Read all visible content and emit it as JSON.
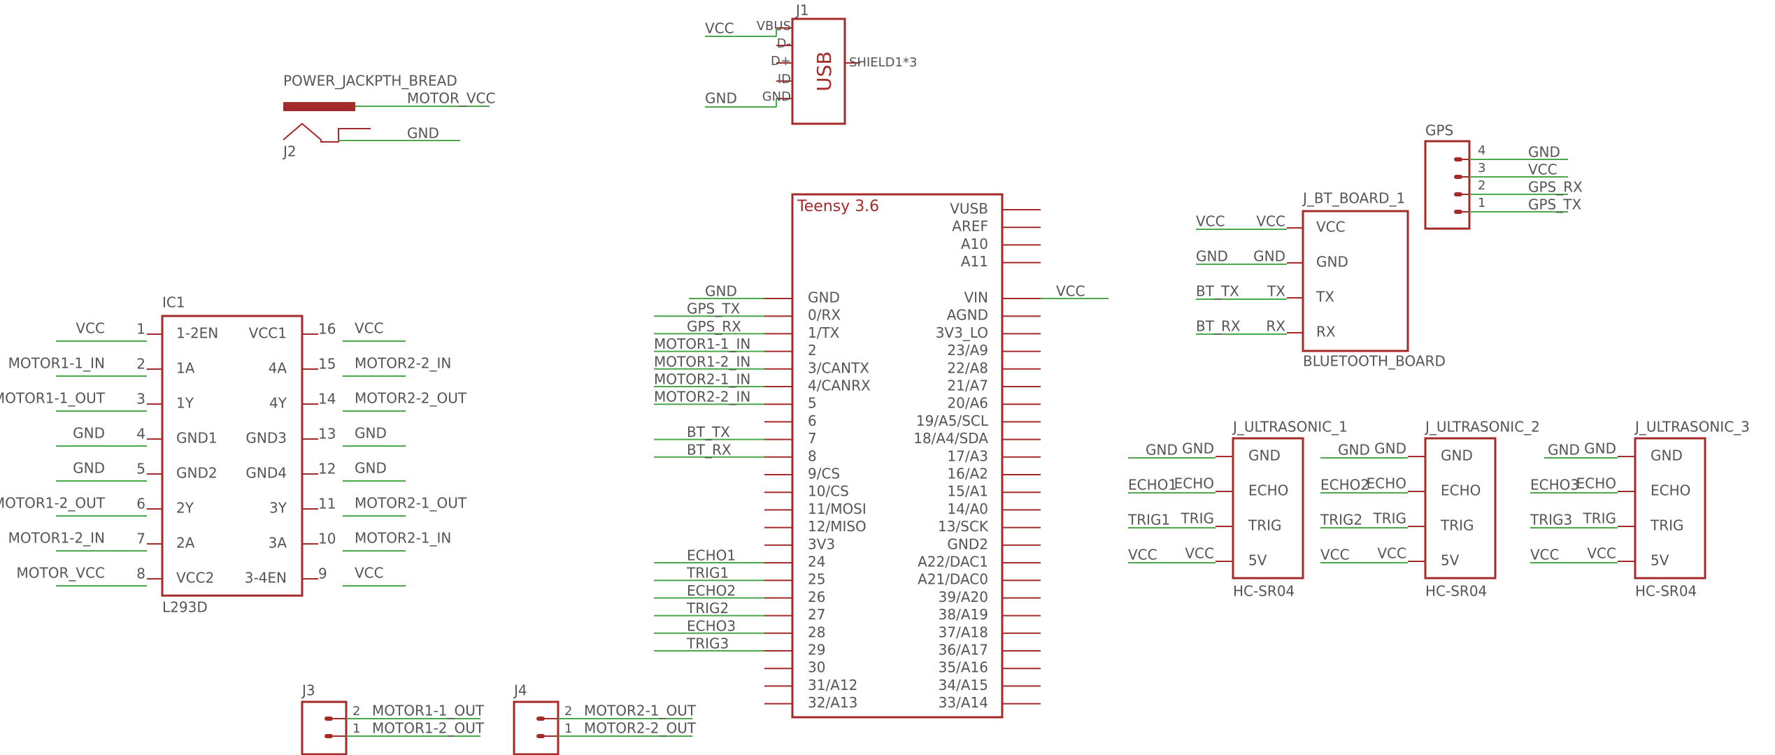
{
  "colors": {
    "body": "#a52a2a",
    "wire": "#4ca64c",
    "label": "#555555",
    "background": "#ffffff"
  },
  "power_jack": {
    "title": "POWER_JACKPTH_BREAD",
    "ref": "J2",
    "net1": "MOTOR_VCC",
    "net2": "GND"
  },
  "usb": {
    "ref": "J1",
    "text": "USB",
    "pins": [
      "VBUS",
      "D-",
      "D+",
      "ID",
      "GND"
    ],
    "shield": "SHIELD1*3",
    "net_vcc": "VCC",
    "net_gnd": "GND"
  },
  "ic1": {
    "ref": "IC1",
    "value": "L293D",
    "left": [
      {
        "num": "1",
        "name": "1-2EN",
        "net": "VCC"
      },
      {
        "num": "2",
        "name": "1A",
        "net": "MOTOR1-1_IN"
      },
      {
        "num": "3",
        "name": "1Y",
        "net": "MOTOR1-1_OUT"
      },
      {
        "num": "4",
        "name": "GND1",
        "net": "GND"
      },
      {
        "num": "5",
        "name": "GND2",
        "net": "GND"
      },
      {
        "num": "6",
        "name": "2Y",
        "net": "MOTOR1-2_OUT"
      },
      {
        "num": "7",
        "name": "2A",
        "net": "MOTOR1-2_IN"
      },
      {
        "num": "8",
        "name": "VCC2",
        "net": "MOTOR_VCC"
      }
    ],
    "right": [
      {
        "num": "16",
        "name": "VCC1",
        "net": "VCC"
      },
      {
        "num": "15",
        "name": "4A",
        "net": "MOTOR2-2_IN"
      },
      {
        "num": "14",
        "name": "4Y",
        "net": "MOTOR2-2_OUT"
      },
      {
        "num": "13",
        "name": "GND3",
        "net": "GND"
      },
      {
        "num": "12",
        "name": "GND4",
        "net": "GND"
      },
      {
        "num": "11",
        "name": "3Y",
        "net": "MOTOR2-1_OUT"
      },
      {
        "num": "10",
        "name": "3A",
        "net": "MOTOR2-1_IN"
      },
      {
        "num": "9",
        "name": "3-4EN",
        "net": "VCC"
      }
    ]
  },
  "teensy": {
    "title": "Teensy 3.6",
    "left": [
      {
        "name": "GND",
        "net": "GND"
      },
      {
        "name": "0/RX",
        "net": "GPS_TX"
      },
      {
        "name": "1/TX",
        "net": "GPS_RX"
      },
      {
        "name": "2",
        "net": "MOTOR1-1_IN"
      },
      {
        "name": "3/CANTX",
        "net": "MOTOR1-2_IN"
      },
      {
        "name": "4/CANRX",
        "net": "MOTOR2-1_IN"
      },
      {
        "name": "5",
        "net": "MOTOR2-2_IN"
      },
      {
        "name": "6",
        "net": ""
      },
      {
        "name": "7",
        "net": "BT_TX"
      },
      {
        "name": "8",
        "net": "BT_RX"
      },
      {
        "name": "9/CS",
        "net": ""
      },
      {
        "name": "10/CS",
        "net": ""
      },
      {
        "name": "11/MOSI",
        "net": ""
      },
      {
        "name": "12/MISO",
        "net": ""
      },
      {
        "name": "3V3",
        "net": ""
      },
      {
        "name": "24",
        "net": "ECHO1"
      },
      {
        "name": "25",
        "net": "TRIG1"
      },
      {
        "name": "26",
        "net": "ECHO2"
      },
      {
        "name": "27",
        "net": "TRIG2"
      },
      {
        "name": "28",
        "net": "ECHO3"
      },
      {
        "name": "29",
        "net": "TRIG3"
      },
      {
        "name": "30",
        "net": ""
      },
      {
        "name": "31/A12",
        "net": ""
      },
      {
        "name": "32/A13",
        "net": ""
      }
    ],
    "right_top": [
      {
        "name": "VUSB",
        "net": ""
      },
      {
        "name": "AREF",
        "net": ""
      },
      {
        "name": "A10",
        "net": ""
      },
      {
        "name": "A11",
        "net": ""
      }
    ],
    "right": [
      {
        "name": "VIN",
        "net": "VCC"
      },
      {
        "name": "AGND",
        "net": ""
      },
      {
        "name": "3V3_LO",
        "net": ""
      },
      {
        "name": "23/A9",
        "net": ""
      },
      {
        "name": "22/A8",
        "net": ""
      },
      {
        "name": "21/A7",
        "net": ""
      },
      {
        "name": "20/A6",
        "net": ""
      },
      {
        "name": "19/A5/SCL",
        "net": ""
      },
      {
        "name": "18/A4/SDA",
        "net": ""
      },
      {
        "name": "17/A3",
        "net": ""
      },
      {
        "name": "16/A2",
        "net": ""
      },
      {
        "name": "15/A1",
        "net": ""
      },
      {
        "name": "14/A0",
        "net": ""
      },
      {
        "name": "13/SCK",
        "net": ""
      },
      {
        "name": "GND2",
        "net": ""
      },
      {
        "name": "A22/DAC1",
        "net": ""
      },
      {
        "name": "A21/DAC0",
        "net": ""
      },
      {
        "name": "39/A20",
        "net": ""
      },
      {
        "name": "38/A19",
        "net": ""
      },
      {
        "name": "37/A18",
        "net": ""
      },
      {
        "name": "36/A17",
        "net": ""
      },
      {
        "name": "35/A16",
        "net": ""
      },
      {
        "name": "34/A15",
        "net": ""
      },
      {
        "name": "33/A14",
        "net": ""
      }
    ]
  },
  "gps": {
    "ref": "GPS",
    "pins": [
      {
        "num": "4",
        "net": "GND"
      },
      {
        "num": "3",
        "net": "VCC"
      },
      {
        "num": "2",
        "net": "GPS_RX"
      },
      {
        "num": "1",
        "net": "GPS_TX"
      }
    ]
  },
  "bt": {
    "ref": "J_BT_BOARD_1",
    "value": "BLUETOOTH_BOARD",
    "pins": [
      {
        "name": "VCC",
        "pad": "VCC",
        "net": "VCC"
      },
      {
        "name": "GND",
        "pad": "GND",
        "net": "GND"
      },
      {
        "name": "TX",
        "pad": "TX",
        "net": "BT_TX"
      },
      {
        "name": "RX",
        "pad": "RX",
        "net": "BT_RX"
      }
    ]
  },
  "ultrasonics": [
    {
      "ref": "J_ULTRASONIC_1",
      "value": "HC-SR04",
      "pins": [
        {
          "name": "GND",
          "pad": "GND",
          "net": "GND"
        },
        {
          "name": "ECHO",
          "pad": "ECHO",
          "net": "ECHO1"
        },
        {
          "name": "TRIG",
          "pad": "TRIG",
          "net": "TRIG1"
        },
        {
          "name": "5V",
          "pad": "VCC",
          "net": "VCC"
        }
      ]
    },
    {
      "ref": "J_ULTRASONIC_2",
      "value": "HC-SR04",
      "pins": [
        {
          "name": "GND",
          "pad": "GND",
          "net": "GND"
        },
        {
          "name": "ECHO",
          "pad": "ECHO",
          "net": "ECHO2"
        },
        {
          "name": "TRIG",
          "pad": "TRIG",
          "net": "TRIG2"
        },
        {
          "name": "5V",
          "pad": "VCC",
          "net": "VCC"
        }
      ]
    },
    {
      "ref": "J_ULTRASONIC_3",
      "value": "HC-SR04",
      "pins": [
        {
          "name": "GND",
          "pad": "GND",
          "net": "GND"
        },
        {
          "name": "ECHO",
          "pad": "ECHO",
          "net": "ECHO3"
        },
        {
          "name": "TRIG",
          "pad": "TRIG",
          "net": "TRIG3"
        },
        {
          "name": "5V",
          "pad": "VCC",
          "net": "VCC"
        }
      ]
    }
  ],
  "j3": {
    "ref": "J3",
    "pins": [
      {
        "num": "2",
        "net": "MOTOR1-1_OUT"
      },
      {
        "num": "1",
        "net": "MOTOR1-2_OUT"
      }
    ]
  },
  "j4": {
    "ref": "J4",
    "pins": [
      {
        "num": "2",
        "net": "MOTOR2-1_OUT"
      },
      {
        "num": "1",
        "net": "MOTOR2-2_OUT"
      }
    ]
  }
}
